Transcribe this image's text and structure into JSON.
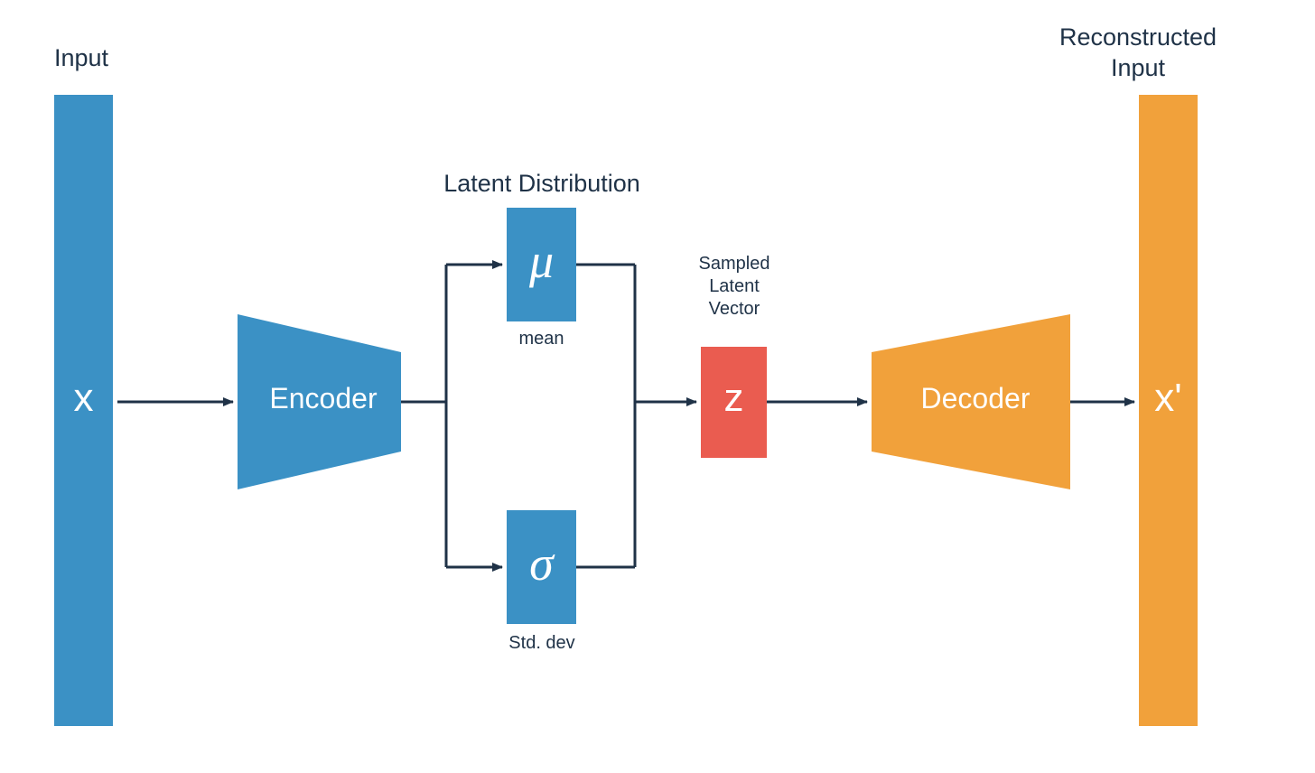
{
  "labels": {
    "input": "Input",
    "reconstructed_input": "Reconstructed\nInput",
    "latent_distribution": "Latent Distribution",
    "sampled_latent_vector": "Sampled\nLatent\nVector",
    "mean_sub": "mean",
    "std_sub": "Std. dev"
  },
  "blocks": {
    "input_x": "x",
    "encoder": "Encoder",
    "mu": "μ",
    "sigma": "σ",
    "z": "z",
    "decoder": "Decoder",
    "output_xprime": "x'"
  },
  "colors": {
    "blue": "#3b91c5",
    "orange": "#f1a13b",
    "red": "#ea5c50",
    "text": "#1f3247",
    "arrow": "#1f3247"
  }
}
